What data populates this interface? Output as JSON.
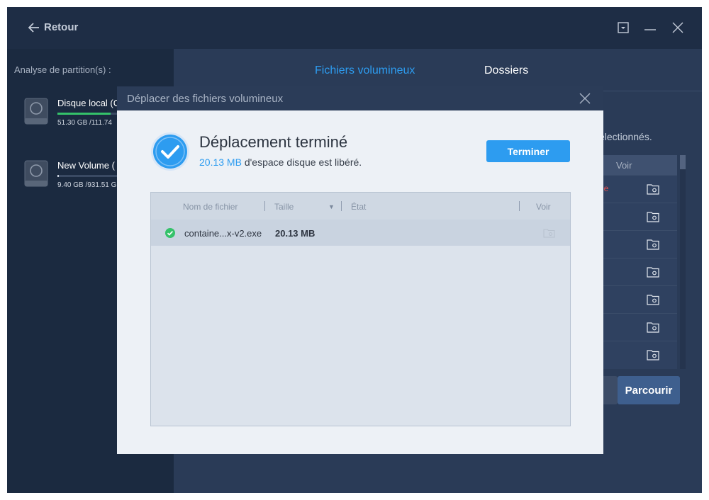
{
  "header": {
    "back_label": "Retour"
  },
  "sidebar": {
    "title": "Analyse de partition(s) :",
    "disks": [
      {
        "name": "Disque local (C",
        "size": "51.30 GB /111.74",
        "used_fraction": 0.46,
        "bar_color": "#35c26a"
      },
      {
        "name": "New Volume (",
        "size": "9.40 GB /931.51 G",
        "used_fraction": 0.01,
        "bar_color": "#c9d1dd"
      }
    ]
  },
  "main": {
    "tabs": [
      {
        "label": "Fichiers volumineux",
        "active": true
      },
      {
        "label": "Dossiers",
        "active": false
      }
    ],
    "selection_text": "électionnés.",
    "table_header_view": "Voir",
    "partial_status": "ée",
    "browse_button": "Parcourir"
  },
  "dialog": {
    "title": "Déplacer des fichiers volumineux",
    "heading": "Déplacement terminé",
    "freed_amount": "20.13 MB",
    "freed_text": " d'espace disque est libéré.",
    "finish_button": "Terminer",
    "columns": {
      "name": "Nom de fichier",
      "size": "Taille",
      "state": "État",
      "view": "Voir"
    },
    "files": [
      {
        "name": "containe...x-v2.exe",
        "size": "20.13 MB",
        "state": "",
        "status_icon": "check-circle-icon"
      }
    ]
  },
  "colors": {
    "accent": "#2d9cf0",
    "success": "#35c26a",
    "error": "#e25050"
  }
}
